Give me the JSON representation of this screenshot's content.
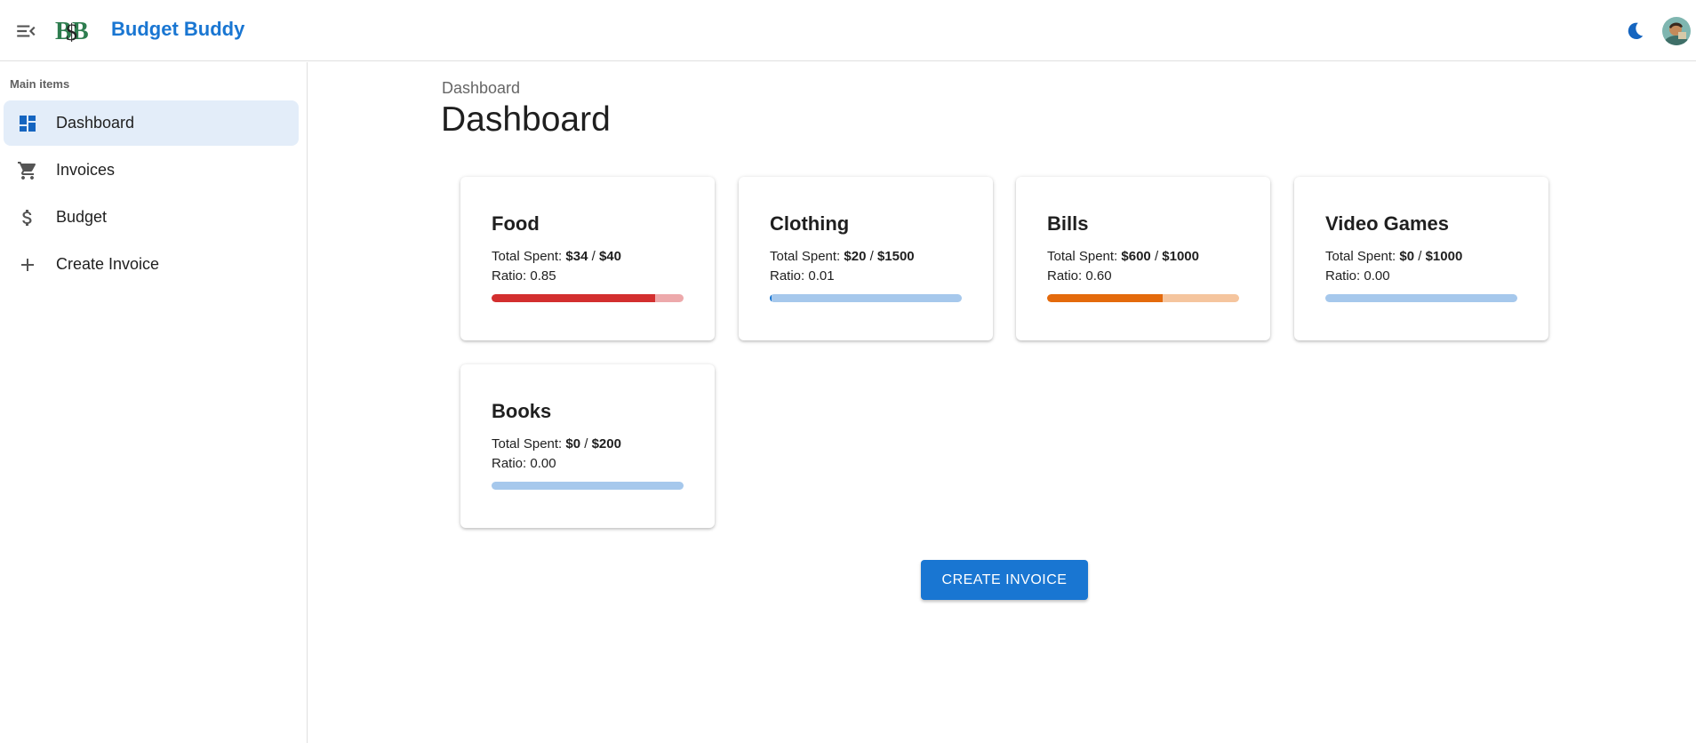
{
  "header": {
    "app_title": "Budget Buddy",
    "logo_text": "B$B",
    "icons": {
      "menu": "menu-collapse-icon",
      "theme": "moon-icon",
      "avatar": "user-avatar"
    },
    "brand_color": "#1976d2"
  },
  "sidebar": {
    "section_label": "Main items",
    "items": [
      {
        "label": "Dashboard",
        "icon": "dashboard-icon",
        "active": true
      },
      {
        "label": "Invoices",
        "icon": "cart-icon",
        "active": false
      },
      {
        "label": "Budget",
        "icon": "dollar-icon",
        "active": false
      },
      {
        "label": "Create Invoice",
        "icon": "plus-icon",
        "active": false
      }
    ]
  },
  "main": {
    "breadcrumb": "Dashboard",
    "title": "Dashboard",
    "cards": [
      {
        "name": "Food",
        "spent_prefix": "Total Spent:",
        "spent": "$34",
        "separator": "/",
        "budget": "$40",
        "ratio_text": "Ratio: 0.85",
        "ratio": 0.85,
        "bar_color": "#d32f2f",
        "track_color": "#eda9ab"
      },
      {
        "name": "Clothing",
        "spent_prefix": "Total Spent:",
        "spent": "$20",
        "separator": "/",
        "budget": "$1500",
        "ratio_text": "Ratio: 0.01",
        "ratio": 0.01,
        "bar_color": "#1976d2",
        "track_color": "#a6c8ec"
      },
      {
        "name": "Bills",
        "spent_prefix": "Total Spent:",
        "spent": "$600",
        "separator": "/",
        "budget": "$1000",
        "ratio_text": "Ratio: 0.60",
        "ratio": 0.6,
        "bar_color": "#e46a0c",
        "track_color": "#f5c59e"
      },
      {
        "name": "Video Games",
        "spent_prefix": "Total Spent:",
        "spent": "$0",
        "separator": "/",
        "budget": "$1000",
        "ratio_text": "Ratio: 0.00",
        "ratio": 0.0,
        "bar_color": "#1976d2",
        "track_color": "#a6c8ec"
      },
      {
        "name": "Books",
        "spent_prefix": "Total Spent:",
        "spent": "$0",
        "separator": "/",
        "budget": "$200",
        "ratio_text": "Ratio: 0.00",
        "ratio": 0.0,
        "bar_color": "#1976d2",
        "track_color": "#a6c8ec"
      }
    ],
    "create_button_label": "CREATE INVOICE"
  }
}
